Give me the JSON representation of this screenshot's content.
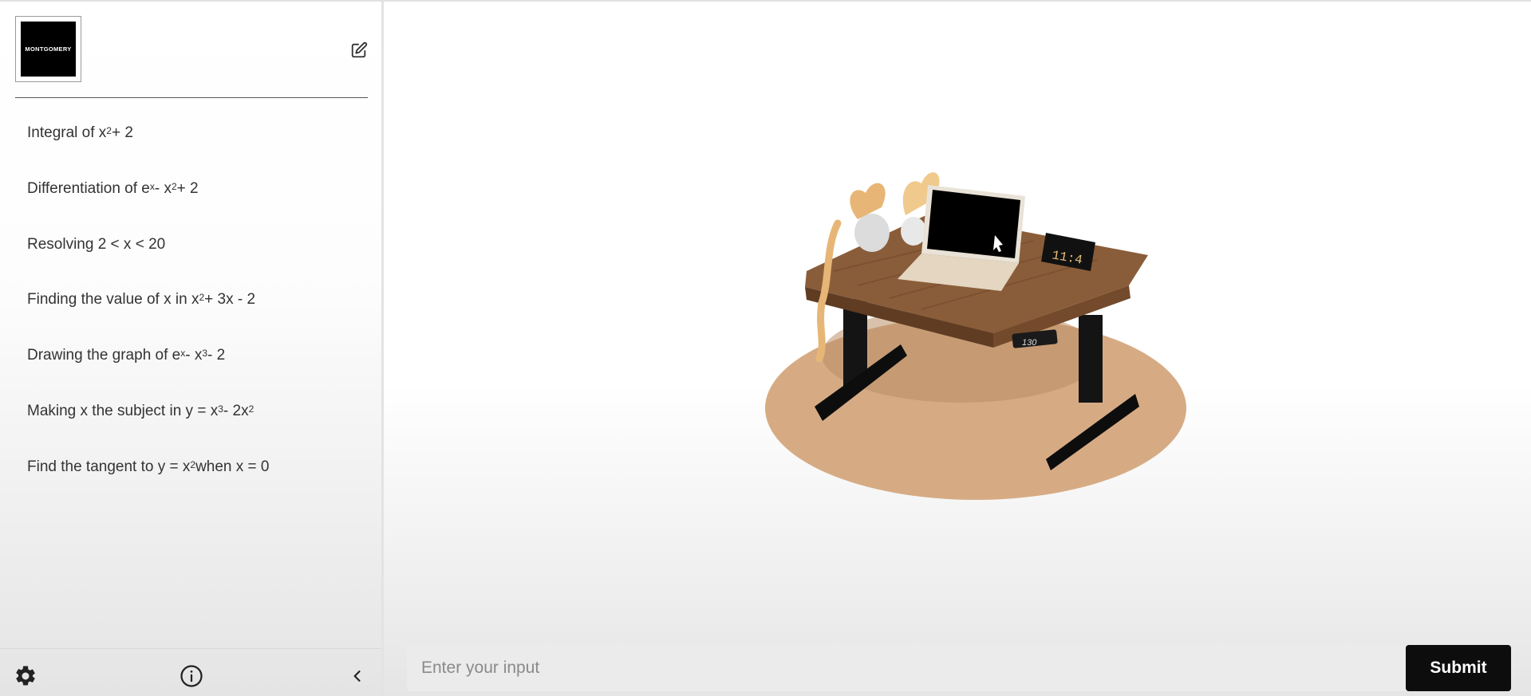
{
  "logo": {
    "text": "MONTGOMERY"
  },
  "history": [
    {
      "parts": [
        "Integral of x",
        "2",
        " + 2"
      ]
    },
    {
      "parts": [
        "Differentiation of e",
        "x",
        " - x",
        "2",
        " + 2"
      ]
    },
    {
      "parts": [
        "Resolving 2 < x < 20"
      ]
    },
    {
      "parts": [
        "Finding the value of x in x",
        "2",
        " + 3x - 2"
      ]
    },
    {
      "parts": [
        "Drawing the graph of e",
        "x",
        " - x",
        "3",
        " - 2"
      ]
    },
    {
      "parts": [
        "Making x the subject in y = x",
        "3",
        " - 2x",
        "2"
      ]
    },
    {
      "parts": [
        "Find the tangent to y = x",
        "2",
        " when x = 0"
      ]
    }
  ],
  "illustration": {
    "clock_text": "11:4",
    "desk_panel_text": "130"
  },
  "composer": {
    "placeholder": "Enter your input",
    "submit_label": "Submit"
  },
  "icons": {
    "new_chat": "edit-icon",
    "settings": "gear-icon",
    "info": "info-icon",
    "collapse": "chevron-left-icon"
  }
}
